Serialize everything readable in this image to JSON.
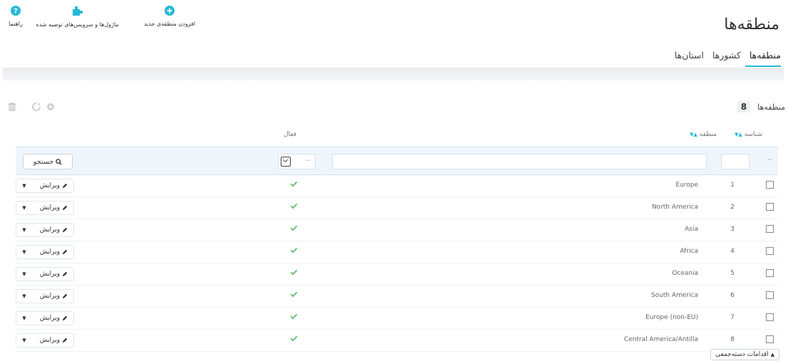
{
  "page": {
    "title": "منطقه‌ها"
  },
  "toolbar": {
    "help_label": "راهنما",
    "modules_label": "ماژول‌ها و سرویس‌های توصیه شده",
    "add_label": "افزودن منطقه‌ی جدید",
    "help_icon": "question-circle-icon",
    "modules_icon": "puzzle-icon",
    "add_icon": "plus-circle-icon",
    "icon_color": "#25b9d7"
  },
  "tabs": [
    {
      "label": "منطقه‌ها",
      "active": true
    },
    {
      "label": "کشورها",
      "active": false
    },
    {
      "label": "استان‌ها",
      "active": false
    }
  ],
  "panel": {
    "title": "منطقه‌ها",
    "count": "8"
  },
  "columns": {
    "id": "شناسه",
    "zone": "منطقه",
    "active": "فعال"
  },
  "filters": {
    "search_label": "جستجو",
    "dash": "--"
  },
  "row_actions": {
    "edit_label": "ویرایش"
  },
  "rows": [
    {
      "id": "1",
      "name": "Europe",
      "active": true
    },
    {
      "id": "2",
      "name": "North America",
      "active": true
    },
    {
      "id": "3",
      "name": "Asia",
      "active": true
    },
    {
      "id": "4",
      "name": "Africa",
      "active": true
    },
    {
      "id": "5",
      "name": "Oceania",
      "active": true
    },
    {
      "id": "6",
      "name": "South America",
      "active": true
    },
    {
      "id": "7",
      "name": "Europe (non-EU)",
      "active": true
    },
    {
      "id": "8",
      "name": "Central America/Antilla",
      "active": true
    }
  ],
  "bulk": {
    "label": "اقدامات دسته‌جمعی"
  },
  "colors": {
    "accent": "#25b9d7",
    "check_green": "#72c279"
  }
}
